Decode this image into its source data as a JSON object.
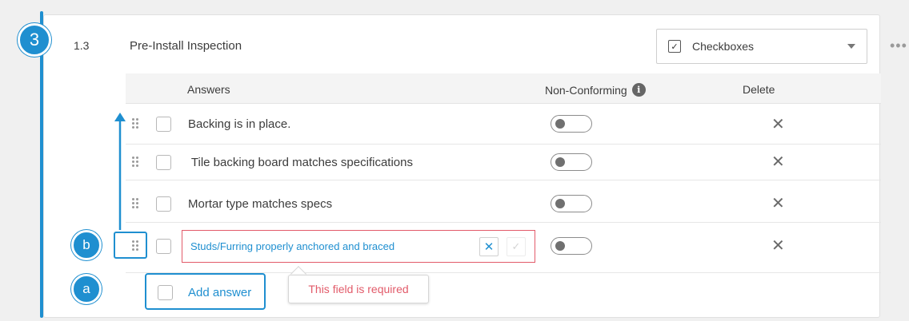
{
  "step_badge": "3",
  "callouts": {
    "a": "a",
    "b": "b"
  },
  "question": {
    "number": "1.3",
    "title": "Pre-Install Inspection",
    "type_select": {
      "checkbox_glyph": "✓",
      "label": "Checkboxes",
      "icon": "chevron-down-icon"
    },
    "more_menu": "•••"
  },
  "table": {
    "headers": {
      "answers": "Answers",
      "non_conforming": "Non-Conforming",
      "info": "i",
      "delete": "Delete"
    },
    "rows": [
      {
        "text": "Backing is in place.",
        "non_conforming": false
      },
      {
        "text": " Tile backing board matches specifications",
        "non_conforming": false
      },
      {
        "text": "Mortar type matches specs",
        "non_conforming": false
      },
      {
        "text": "Studs/Furring properly anchored and braced",
        "non_conforming": false,
        "editing": true
      }
    ],
    "delete_glyph": "✕",
    "edit_cancel_glyph": "✕",
    "edit_confirm_glyph": "✓"
  },
  "validation": {
    "message": "This field is required"
  },
  "add_answer": {
    "label": "Add answer"
  },
  "colors": {
    "accent": "#1f8fd0",
    "error": "#e25b6a",
    "text": "#3c3c3c"
  }
}
